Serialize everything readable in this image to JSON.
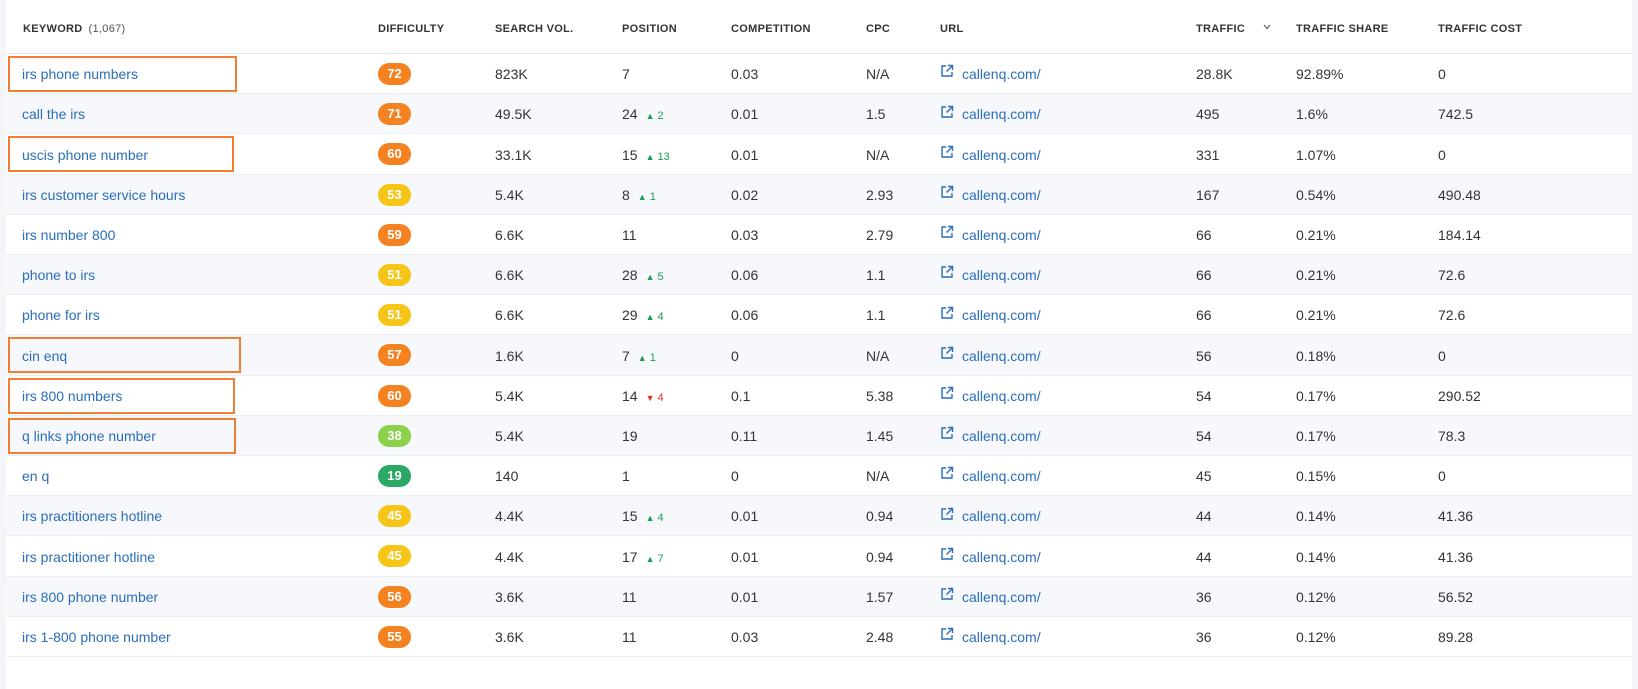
{
  "header": {
    "keyword": "KEYWORD",
    "keyword_count": "(1,067)",
    "difficulty": "DIFFICULTY",
    "search_vol": "SEARCH VOL.",
    "position": "POSITION",
    "competition": "COMPETITION",
    "cpc": "CPC",
    "url": "URL",
    "traffic": "TRAFFIC",
    "traffic_share": "TRAFFIC SHARE",
    "traffic_cost": "TRAFFIC COST",
    "sort_icon": "chevron-down-icon"
  },
  "colors": {
    "orange": "#f58220",
    "yellow": "#f5c518",
    "lightgreen": "#8bd14a",
    "green": "#2aa866",
    "highlight_box": "#f07f34",
    "link": "#2a6ebb"
  },
  "rows": [
    {
      "keyword": "irs phone numbers",
      "highlighted": true,
      "difficulty": "72",
      "diff_color": "#f58220",
      "search_vol": "823K",
      "position": "7",
      "delta": "",
      "delta_dir": "",
      "competition": "0.03",
      "cpc": "N/A",
      "url": "callenq.com/",
      "traffic": "28.8K",
      "traffic_share": "92.89%",
      "traffic_cost": "0"
    },
    {
      "keyword": "call the irs",
      "highlighted": false,
      "difficulty": "71",
      "diff_color": "#f58220",
      "search_vol": "49.5K",
      "position": "24",
      "delta": "2",
      "delta_dir": "up",
      "competition": "0.01",
      "cpc": "1.5",
      "url": "callenq.com/",
      "traffic": "495",
      "traffic_share": "1.6%",
      "traffic_cost": "742.5"
    },
    {
      "keyword": "uscis phone number",
      "highlighted": true,
      "difficulty": "60",
      "diff_color": "#f58220",
      "search_vol": "33.1K",
      "position": "15",
      "delta": "13",
      "delta_dir": "up",
      "competition": "0.01",
      "cpc": "N/A",
      "url": "callenq.com/",
      "traffic": "331",
      "traffic_share": "1.07%",
      "traffic_cost": "0"
    },
    {
      "keyword": "irs customer service hours",
      "highlighted": false,
      "difficulty": "53",
      "diff_color": "#f5c518",
      "search_vol": "5.4K",
      "position": "8",
      "delta": "1",
      "delta_dir": "up",
      "competition": "0.02",
      "cpc": "2.93",
      "url": "callenq.com/",
      "traffic": "167",
      "traffic_share": "0.54%",
      "traffic_cost": "490.48"
    },
    {
      "keyword": "irs number 800",
      "highlighted": false,
      "difficulty": "59",
      "diff_color": "#f58220",
      "search_vol": "6.6K",
      "position": "11",
      "delta": "",
      "delta_dir": "",
      "competition": "0.03",
      "cpc": "2.79",
      "url": "callenq.com/",
      "traffic": "66",
      "traffic_share": "0.21%",
      "traffic_cost": "184.14"
    },
    {
      "keyword": "phone to irs",
      "highlighted": false,
      "difficulty": "51",
      "diff_color": "#f5c518",
      "search_vol": "6.6K",
      "position": "28",
      "delta": "5",
      "delta_dir": "up",
      "competition": "0.06",
      "cpc": "1.1",
      "url": "callenq.com/",
      "traffic": "66",
      "traffic_share": "0.21%",
      "traffic_cost": "72.6"
    },
    {
      "keyword": "phone for irs",
      "highlighted": false,
      "difficulty": "51",
      "diff_color": "#f5c518",
      "search_vol": "6.6K",
      "position": "29",
      "delta": "4",
      "delta_dir": "up",
      "competition": "0.06",
      "cpc": "1.1",
      "url": "callenq.com/",
      "traffic": "66",
      "traffic_share": "0.21%",
      "traffic_cost": "72.6"
    },
    {
      "keyword": "cin enq",
      "highlighted": true,
      "difficulty": "57",
      "diff_color": "#f58220",
      "search_vol": "1.6K",
      "position": "7",
      "delta": "1",
      "delta_dir": "up",
      "competition": "0",
      "cpc": "N/A",
      "url": "callenq.com/",
      "traffic": "56",
      "traffic_share": "0.18%",
      "traffic_cost": "0"
    },
    {
      "keyword": "irs 800 numbers",
      "highlighted": true,
      "difficulty": "60",
      "diff_color": "#f58220",
      "search_vol": "5.4K",
      "position": "14",
      "delta": "4",
      "delta_dir": "down",
      "competition": "0.1",
      "cpc": "5.38",
      "url": "callenq.com/",
      "traffic": "54",
      "traffic_share": "0.17%",
      "traffic_cost": "290.52"
    },
    {
      "keyword": "q links phone number",
      "highlighted": true,
      "difficulty": "38",
      "diff_color": "#8bd14a",
      "search_vol": "5.4K",
      "position": "19",
      "delta": "",
      "delta_dir": "",
      "competition": "0.11",
      "cpc": "1.45",
      "url": "callenq.com/",
      "traffic": "54",
      "traffic_share": "0.17%",
      "traffic_cost": "78.3"
    },
    {
      "keyword": "en q",
      "highlighted": false,
      "difficulty": "19",
      "diff_color": "#2aa866",
      "search_vol": "140",
      "position": "1",
      "delta": "",
      "delta_dir": "",
      "competition": "0",
      "cpc": "N/A",
      "url": "callenq.com/",
      "traffic": "45",
      "traffic_share": "0.15%",
      "traffic_cost": "0"
    },
    {
      "keyword": "irs practitioners hotline",
      "highlighted": false,
      "difficulty": "45",
      "diff_color": "#f5c518",
      "search_vol": "4.4K",
      "position": "15",
      "delta": "4",
      "delta_dir": "up",
      "competition": "0.01",
      "cpc": "0.94",
      "url": "callenq.com/",
      "traffic": "44",
      "traffic_share": "0.14%",
      "traffic_cost": "41.36"
    },
    {
      "keyword": "irs practitioner hotline",
      "highlighted": false,
      "difficulty": "45",
      "diff_color": "#f5c518",
      "search_vol": "4.4K",
      "position": "17",
      "delta": "7",
      "delta_dir": "up",
      "competition": "0.01",
      "cpc": "0.94",
      "url": "callenq.com/",
      "traffic": "44",
      "traffic_share": "0.14%",
      "traffic_cost": "41.36"
    },
    {
      "keyword": "irs 800 phone number",
      "highlighted": false,
      "difficulty": "56",
      "diff_color": "#f58220",
      "search_vol": "3.6K",
      "position": "11",
      "delta": "",
      "delta_dir": "",
      "competition": "0.01",
      "cpc": "1.57",
      "url": "callenq.com/",
      "traffic": "36",
      "traffic_share": "0.12%",
      "traffic_cost": "56.52"
    },
    {
      "keyword": "irs 1-800 phone number",
      "highlighted": false,
      "difficulty": "55",
      "diff_color": "#f58220",
      "search_vol": "3.6K",
      "position": "11",
      "delta": "",
      "delta_dir": "",
      "competition": "0.03",
      "cpc": "2.48",
      "url": "callenq.com/",
      "traffic": "36",
      "traffic_share": "0.12%",
      "traffic_cost": "89.28"
    }
  ]
}
